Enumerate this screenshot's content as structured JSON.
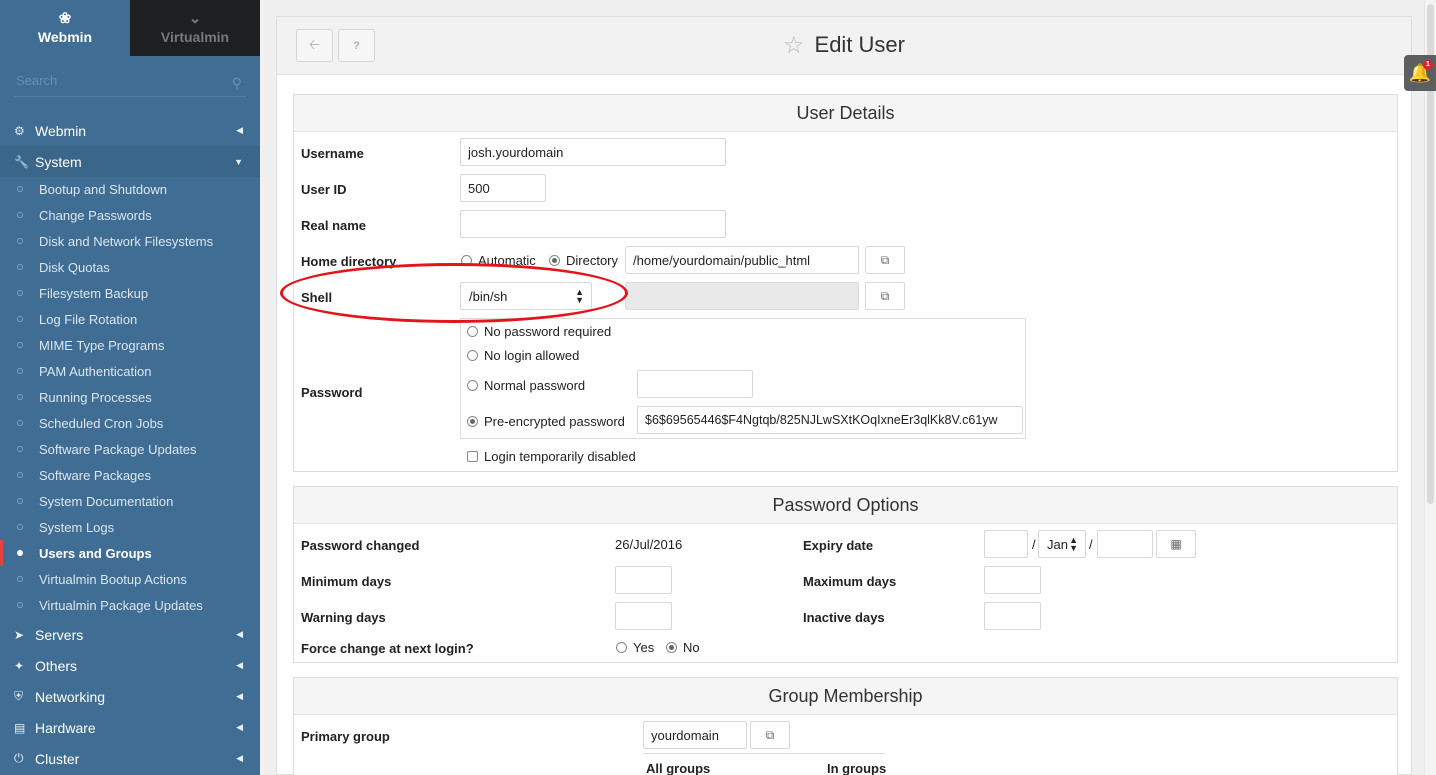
{
  "sidebar": {
    "tabs": [
      {
        "label": "Webmin",
        "icon": "webmin-logo-icon"
      },
      {
        "label": "Virtualmin",
        "icon": "chevron-down-icon"
      }
    ],
    "search_placeholder": "Search",
    "categories": {
      "webmin": {
        "label": "Webmin",
        "icon": "gear-icon"
      },
      "system": {
        "label": "System",
        "icon": "wrench-icon"
      },
      "servers": {
        "label": "Servers",
        "icon": "rocket-icon"
      },
      "others": {
        "label": "Others",
        "icon": "wrench-icon"
      },
      "networking": {
        "label": "Networking",
        "icon": "shield-icon"
      },
      "hardware": {
        "label": "Hardware",
        "icon": "hdd-icon"
      },
      "cluster": {
        "label": "Cluster",
        "icon": "power-icon"
      }
    },
    "system_items": [
      "Bootup and Shutdown",
      "Change Passwords",
      "Disk and Network Filesystems",
      "Disk Quotas",
      "Filesystem Backup",
      "Log File Rotation",
      "MIME Type Programs",
      "PAM Authentication",
      "Running Processes",
      "Scheduled Cron Jobs",
      "Software Package Updates",
      "Software Packages",
      "System Documentation",
      "System Logs",
      "Users and Groups",
      "Virtualmin Bootup Actions",
      "Virtualmin Package Updates"
    ],
    "current_item": "Users and Groups"
  },
  "header": {
    "title": "Edit User",
    "back_icon": "arrow-left-icon",
    "help_icon": "question-icon"
  },
  "user_details": {
    "heading": "User Details",
    "username_label": "Username",
    "username_value": "josh.yourdomain",
    "userid_label": "User ID",
    "userid_value": "500",
    "realname_label": "Real name",
    "realname_value": "",
    "home_label": "Home directory",
    "home_auto": "Automatic",
    "home_dir": "Directory",
    "home_value": "/home/yourdomain/public_html",
    "shell_label": "Shell",
    "shell_value": "/bin/sh",
    "password_label": "Password",
    "pw_none": "No password required",
    "pw_nologin": "No login allowed",
    "pw_normal": "Normal password",
    "pw_preenc": "Pre-encrypted password",
    "pw_hash": "$6$69565446$F4Ngtqb/825NJLwSXtKOqIxneEr3qlKk8V.c61yw",
    "disabled_label": "Login temporarily disabled"
  },
  "password_options": {
    "heading": "Password Options",
    "changed_label": "Password changed",
    "changed_value": "26/Jul/2016",
    "expiry_label": "Expiry date",
    "expiry_day": "",
    "expiry_month": "Jan",
    "expiry_year": "",
    "date_sep": "/",
    "min_label": "Minimum days",
    "max_label": "Maximum days",
    "warn_label": "Warning days",
    "inactive_label": "Inactive days",
    "force_label": "Force change at next login?",
    "yes": "Yes",
    "no": "No"
  },
  "group_membership": {
    "heading": "Group Membership",
    "primary_label": "Primary group",
    "primary_value": "yourdomain",
    "all_groups": "All groups",
    "in_groups": "In groups"
  },
  "notifications": {
    "count": "1"
  },
  "colors": {
    "sidebar": "#3f6d93",
    "highlight": "#e3141b"
  }
}
